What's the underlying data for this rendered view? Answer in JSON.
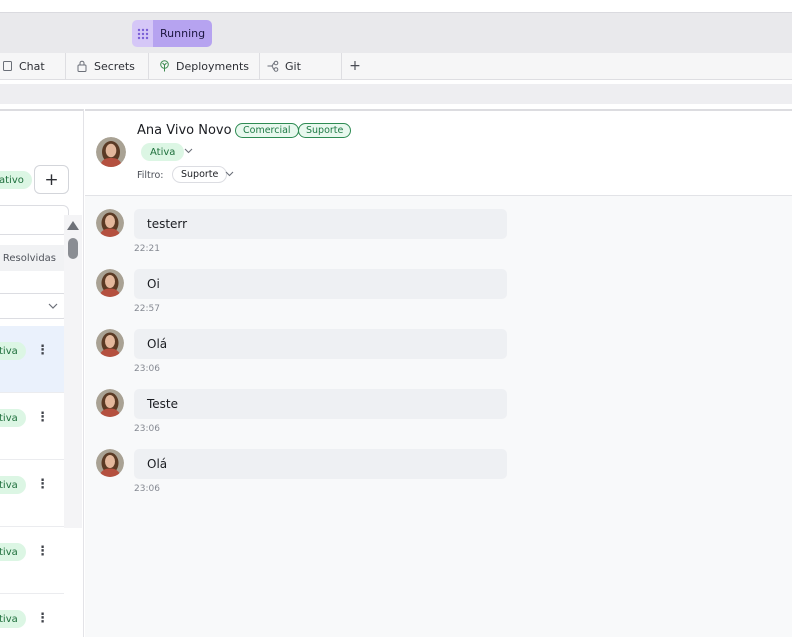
{
  "run": {
    "label": "Running"
  },
  "tabs": [
    {
      "label": "Chat",
      "icon": "chat-icon"
    },
    {
      "label": "Secrets",
      "icon": "lock-icon"
    },
    {
      "label": "Deployments",
      "icon": "deployments-icon"
    },
    {
      "label": "Git",
      "icon": "git-icon"
    }
  ],
  "tab_add": "+",
  "sidebar": {
    "status_badge": "ativo",
    "add_button": "+",
    "filter_resolvidas": "Resolvidas",
    "conversations": [
      {
        "status": "tiva",
        "active": true
      },
      {
        "status": "tiva",
        "active": false
      },
      {
        "status": "tiva",
        "active": false
      },
      {
        "status": "tiva",
        "active": false
      },
      {
        "status": "tiva",
        "active": false
      }
    ]
  },
  "contact": {
    "name": "Ana Vivo Novo",
    "tags": [
      "Comercial",
      "Suporte"
    ],
    "status": "Ativa",
    "filter_label": "Filtro:",
    "filter_value": "Suporte"
  },
  "messages": [
    {
      "text": "testerr",
      "time": "22:21"
    },
    {
      "text": "Oi",
      "time": "22:57"
    },
    {
      "text": "Olá",
      "time": "23:06"
    },
    {
      "text": "Teste",
      "time": "23:06"
    },
    {
      "text": "Olá",
      "time": "23:06"
    }
  ],
  "colors": {
    "run_button": "#b6a3f0",
    "status_green_bg": "#dcf6e4",
    "status_green_text": "#1e6f3c",
    "tag_border": "#2e8b53",
    "active_row": "#eaf1fc",
    "bubble": "#eef0f3"
  }
}
